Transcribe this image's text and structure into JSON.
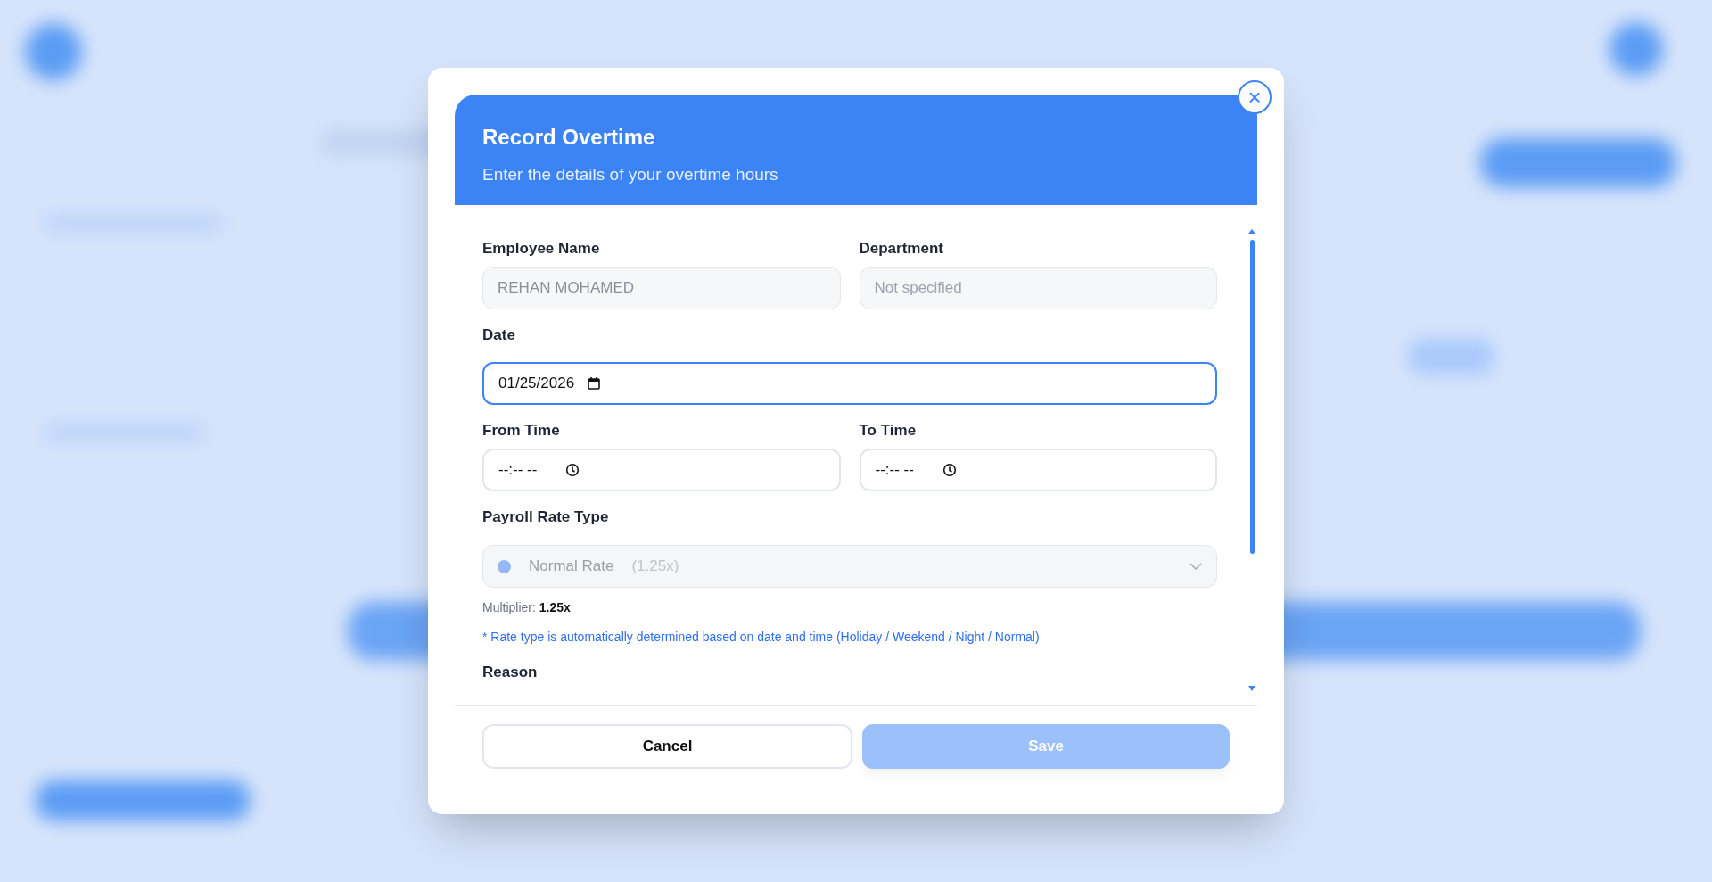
{
  "dialog": {
    "title": "Record Overtime",
    "subtitle": "Enter the details of your overtime hours",
    "close_label": "×"
  },
  "fields": [
    {
      "kind": "readonly",
      "label": "Employee Name",
      "value": "REHAN MOHAMED"
    },
    {
      "kind": "readonly",
      "label": "Department",
      "placeholder": "Not specified"
    },
    {
      "kind": "date",
      "label": "Date",
      "value": "01/25/2026",
      "focused": true
    },
    {
      "kind": "time",
      "label": "From Time",
      "value": "--:-- --",
      "focused": false
    },
    {
      "kind": "time",
      "label": "To Time",
      "value": "--:-- --",
      "focused": false
    }
  ],
  "rate": {
    "label": "Payroll Rate Type",
    "value": "Normal Rate",
    "factor": "(1.25x)",
    "color": "#93b8f8",
    "disabled": true
  },
  "multiplier": {
    "label": "Multiplier:",
    "value": "1.25x"
  },
  "note": "* Rate type is automatically determined based on date and time (Holiday / Weekend / Night / Normal)",
  "reason_label": "Reason",
  "buttons": [
    {
      "kind": "secondary",
      "label": "Cancel",
      "disabled": false
    },
    {
      "kind": "primary",
      "label": "Save",
      "disabled": true
    }
  ]
}
